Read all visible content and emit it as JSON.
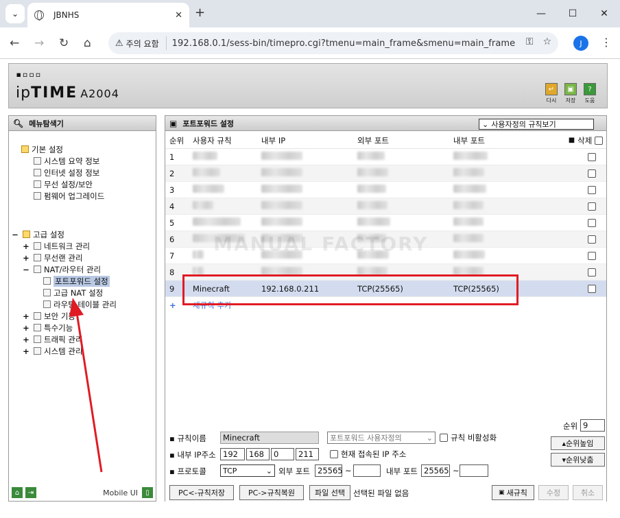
{
  "browser": {
    "tab_title": "JBNHS",
    "security_label": "주의 요함",
    "url": "192.168.0.1/sess-bin/timepro.cgi?tmenu=main_frame&smenu=main_frame",
    "avatar_letter": "J"
  },
  "header": {
    "logo_dots": "▪︎▫︎▫︎▫︎",
    "logo_main": "ip",
    "logo_bold": "TIME",
    "model": "A2004",
    "buttons": [
      {
        "label": "다시"
      },
      {
        "label": "저장"
      },
      {
        "label": "도움"
      }
    ]
  },
  "sidebar": {
    "title": "메뉴탐색기",
    "basic_title": "기본 설정",
    "basic_items": [
      "시스템 요약 정보",
      "인터넷 설정 정보",
      "무선 설정/보안",
      "펌웨어 업그레이드"
    ],
    "adv_title": "고급 설정",
    "adv_items": [
      "네트워크 관리",
      "무선랜 관리",
      "NAT/라우터 관리"
    ],
    "nat_items": [
      "포트포워드 설정",
      "고급 NAT 설정",
      "라우팅 테이블 관리"
    ],
    "other_items": [
      "보안 기능",
      "특수기능",
      "트래픽 관리",
      "시스템 관리"
    ],
    "mobile_label": "Mobile UI"
  },
  "main": {
    "title": "포트포워드 설정",
    "view_select": "사용자정의 규칙보기",
    "columns": [
      "순위",
      "사용자 규칙",
      "내부 IP",
      "외부 포트",
      "내부 포트",
      "삭제"
    ],
    "rows": [
      {
        "num": "1"
      },
      {
        "num": "2"
      },
      {
        "num": "3"
      },
      {
        "num": "4"
      },
      {
        "num": "5"
      },
      {
        "num": "6"
      },
      {
        "num": "7"
      },
      {
        "num": "8"
      },
      {
        "num": "9",
        "name": "Minecraft",
        "ip": "192.168.0.211",
        "ext": "TCP(25565)",
        "int": "TCP(25565)"
      }
    ],
    "add_rule": "새규칙 추가",
    "watermark": "MANUAL FACTORY"
  },
  "form": {
    "rule_name_label": "규칙이름",
    "rule_name_value": "Minecraft",
    "custom_select": "포트포워드 사용자정의",
    "disable_label": "규칙 비활성화",
    "priority_label": "순위",
    "priority_value": "9",
    "up_btn": "순위높임",
    "down_btn": "순위낮춤",
    "ip_label": "내부 IP주소",
    "ip": [
      "192",
      "168",
      "0",
      "211"
    ],
    "current_ip_label": "현재 접속된 IP 주소",
    "proto_label": "프로토콜",
    "proto_value": "TCP",
    "ext_port_label": "외부 포트",
    "ext_port_value": "25565",
    "int_port_label": "내부 포트",
    "int_port_value": "25565",
    "tilde": "~",
    "save_btn": "PC<-규칙저장",
    "restore_btn": "PC->규칙복원",
    "file_btn": "파일 선택",
    "file_status": "선택된 파일 없음",
    "new_btn": "새규칙",
    "edit_btn": "수정",
    "cancel_btn": "취소"
  }
}
